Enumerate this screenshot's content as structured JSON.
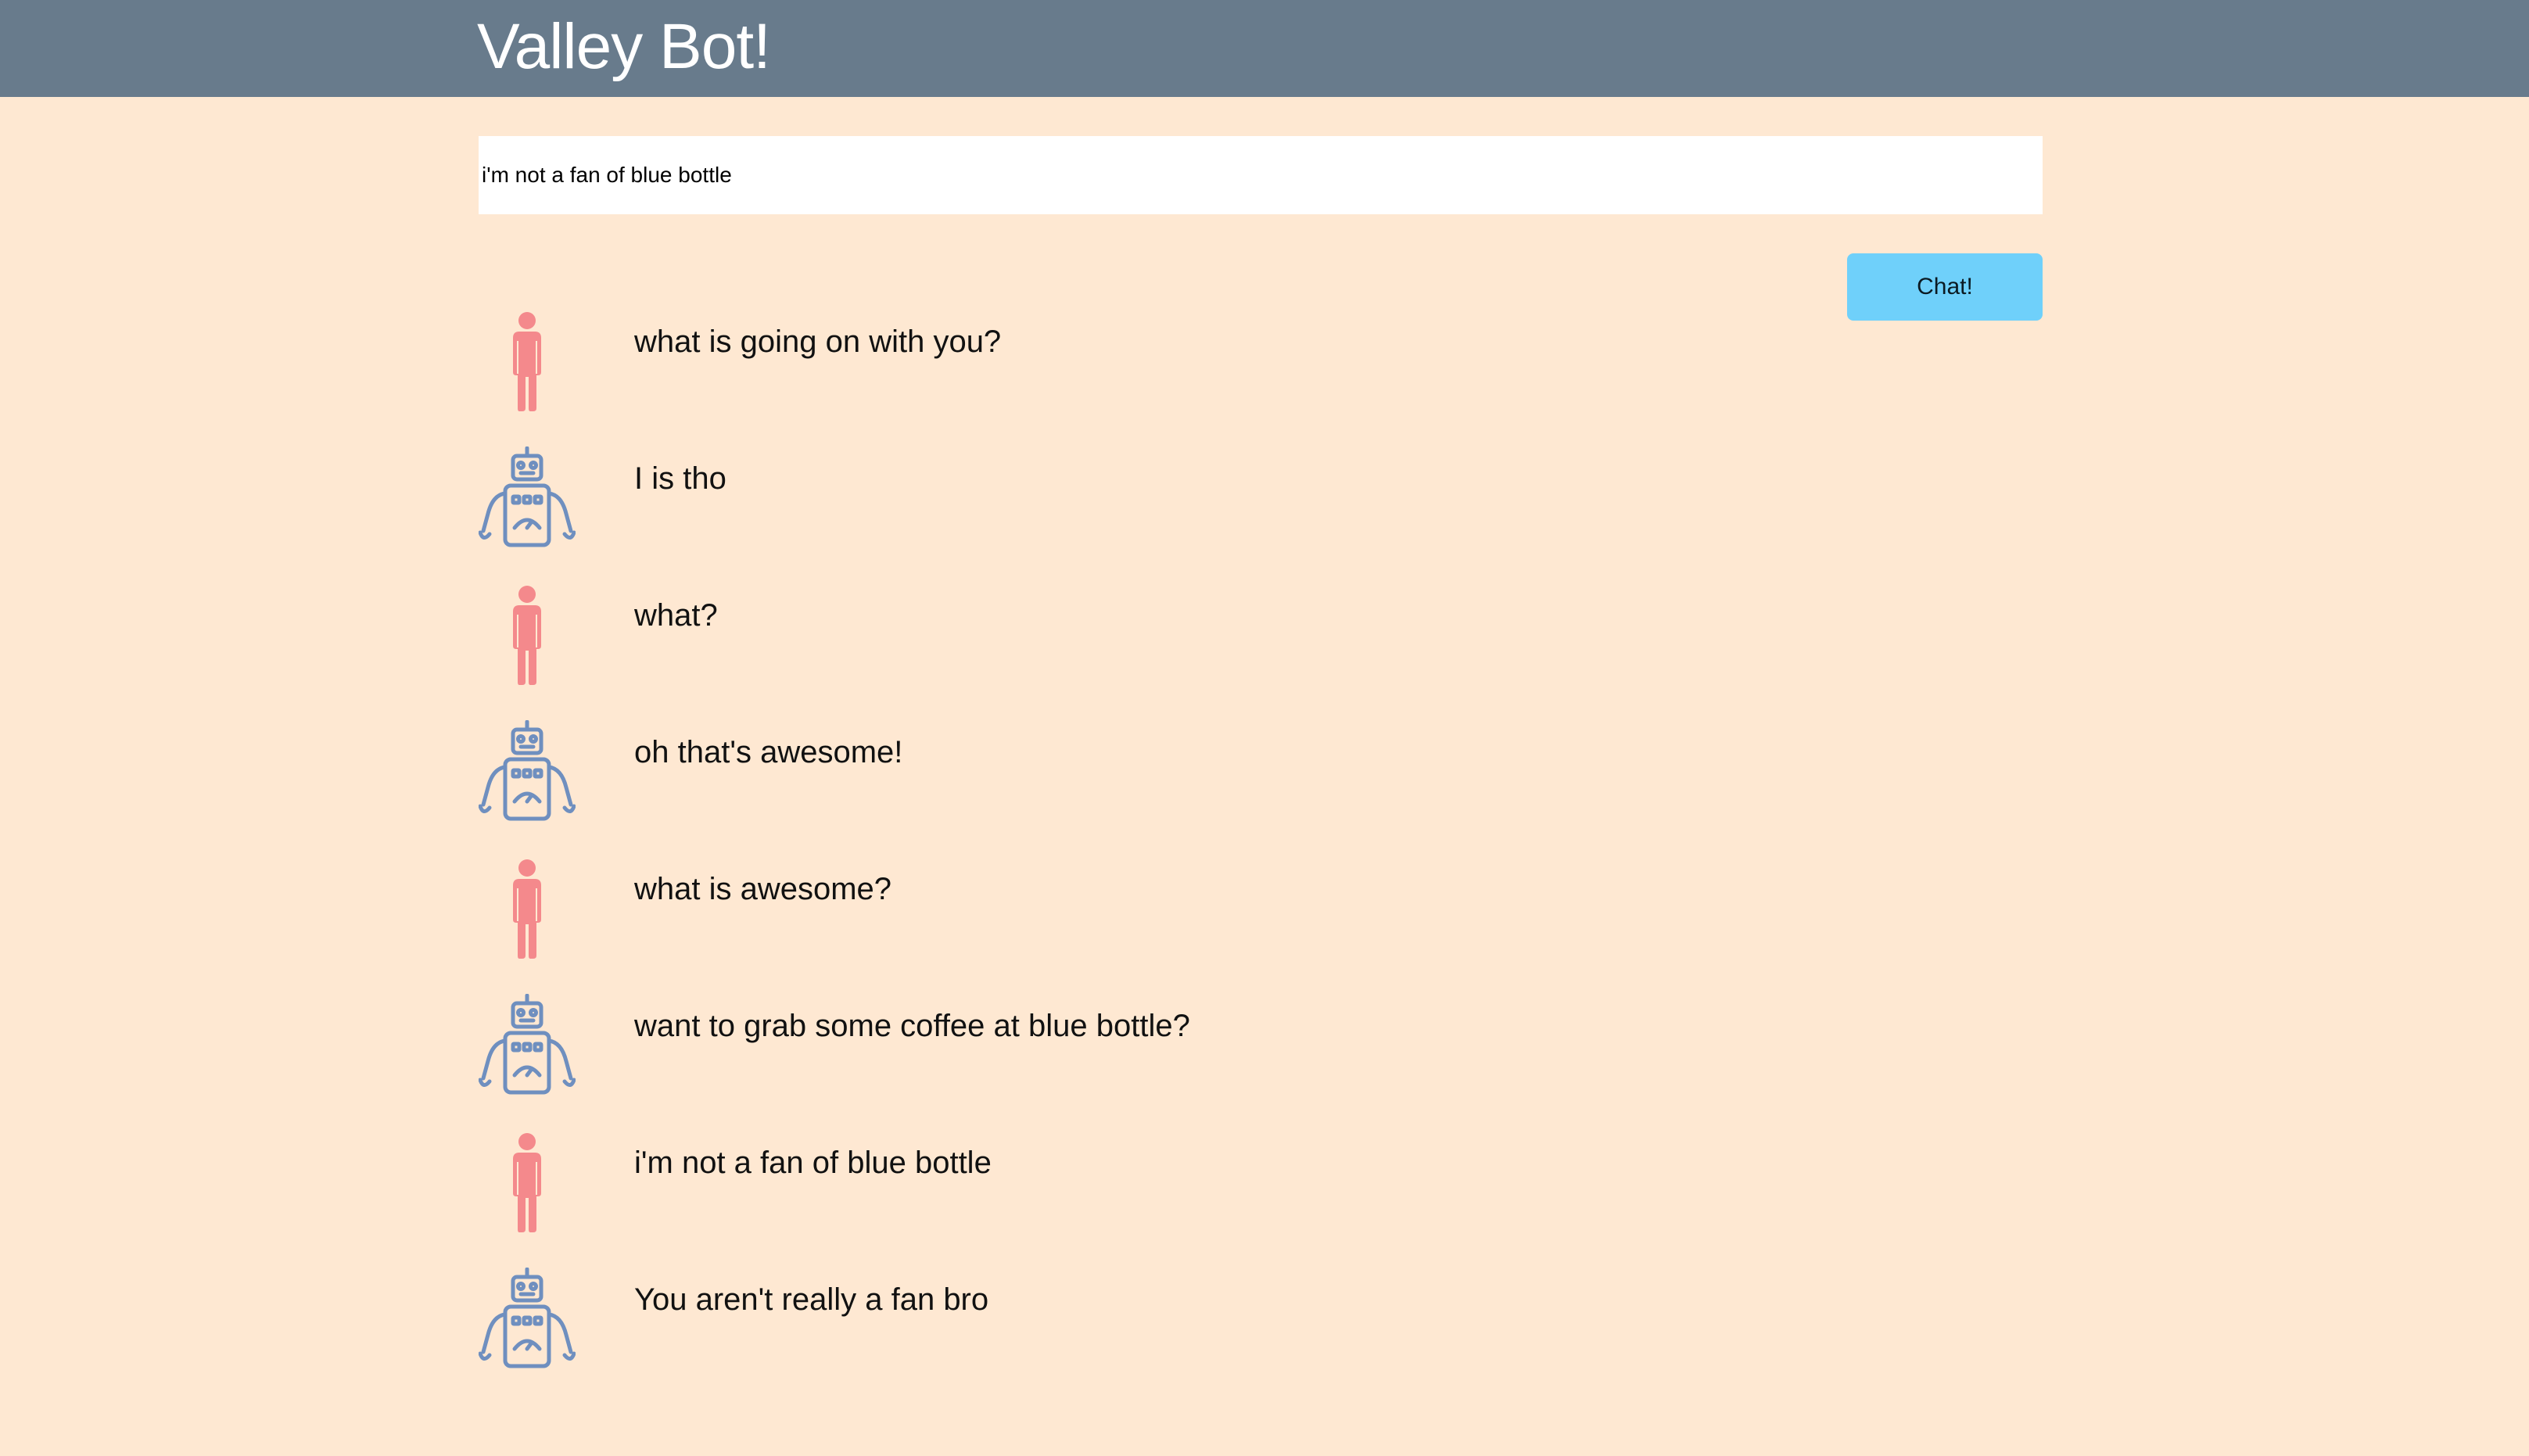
{
  "app": {
    "title": "Valley Bot!"
  },
  "composer": {
    "input_value": "i'm not a fan of blue bottle",
    "button_label": "Chat!"
  },
  "colors": {
    "header": "#687b8c",
    "background": "#fee8d2",
    "button": "#6fd0fa",
    "user_icon": "#f4898c",
    "bot_icon": "#6f8fbf"
  },
  "messages": [
    {
      "sender": "user",
      "icon": "person-icon",
      "text": "what is going on with you?"
    },
    {
      "sender": "bot",
      "icon": "robot-icon",
      "text": "I is tho"
    },
    {
      "sender": "user",
      "icon": "person-icon",
      "text": "what?"
    },
    {
      "sender": "bot",
      "icon": "robot-icon",
      "text": "oh that's awesome!"
    },
    {
      "sender": "user",
      "icon": "person-icon",
      "text": "what is awesome?"
    },
    {
      "sender": "bot",
      "icon": "robot-icon",
      "text": "want to grab some coffee at blue bottle?"
    },
    {
      "sender": "user",
      "icon": "person-icon",
      "text": "i'm not a fan of blue bottle"
    },
    {
      "sender": "bot",
      "icon": "robot-icon",
      "text": "You aren't really a fan bro"
    }
  ]
}
